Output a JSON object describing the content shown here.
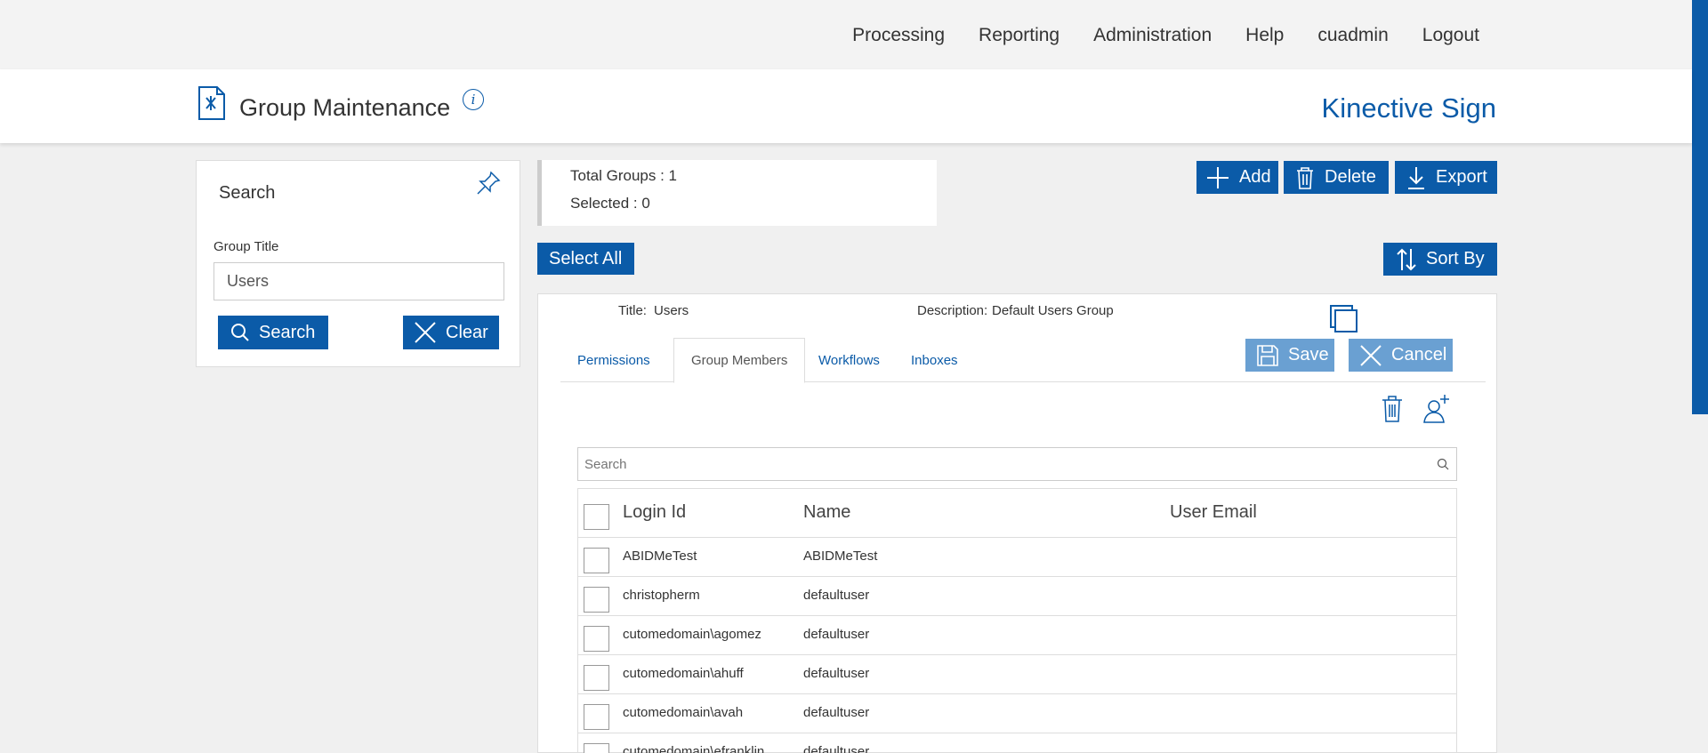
{
  "nav": {
    "items": [
      "Processing",
      "Reporting",
      "Administration",
      "Help",
      "cuadmin",
      "Logout"
    ]
  },
  "header": {
    "title": "Group Maintenance",
    "info": "i",
    "brand": "Kinective Sign"
  },
  "search_panel": {
    "title": "Search",
    "field_label": "Group Title",
    "field_value": "Users",
    "search_label": "Search",
    "clear_label": "Clear"
  },
  "counts": {
    "total": "Total Groups : 1",
    "selected": "Selected : 0"
  },
  "actions": {
    "add": "Add",
    "delete": "Delete",
    "export": "Export",
    "select_all": "Select All",
    "sort_by": "Sort By"
  },
  "group": {
    "title_label": "Title:",
    "title_value": "Users",
    "desc_label": "Description:",
    "desc_value": "Default Users Group",
    "save": "Save",
    "cancel": "Cancel"
  },
  "tabs": [
    "Permissions",
    "Group Members",
    "Workflows",
    "Inboxes"
  ],
  "active_tab": "Group Members",
  "members": {
    "search_placeholder": "Search",
    "columns": [
      "Login Id",
      "Name",
      "User Email"
    ],
    "rows": [
      {
        "login": "ABIDMeTest",
        "name": "ABIDMeTest",
        "email": ""
      },
      {
        "login": "christopherm",
        "name": "defaultuser",
        "email": ""
      },
      {
        "login": "cutomedomain\\agomez",
        "name": "defaultuser",
        "email": ""
      },
      {
        "login": "cutomedomain\\ahuff",
        "name": "defaultuser",
        "email": ""
      },
      {
        "login": "cutomedomain\\avah",
        "name": "defaultuser",
        "email": ""
      },
      {
        "login": "cutomedomain\\efranklin",
        "name": "defaultuser",
        "email": ""
      }
    ]
  },
  "colors": {
    "primary": "#0b5ba8",
    "primary_light": "#6aa0d2",
    "background": "#f0f0f0"
  }
}
